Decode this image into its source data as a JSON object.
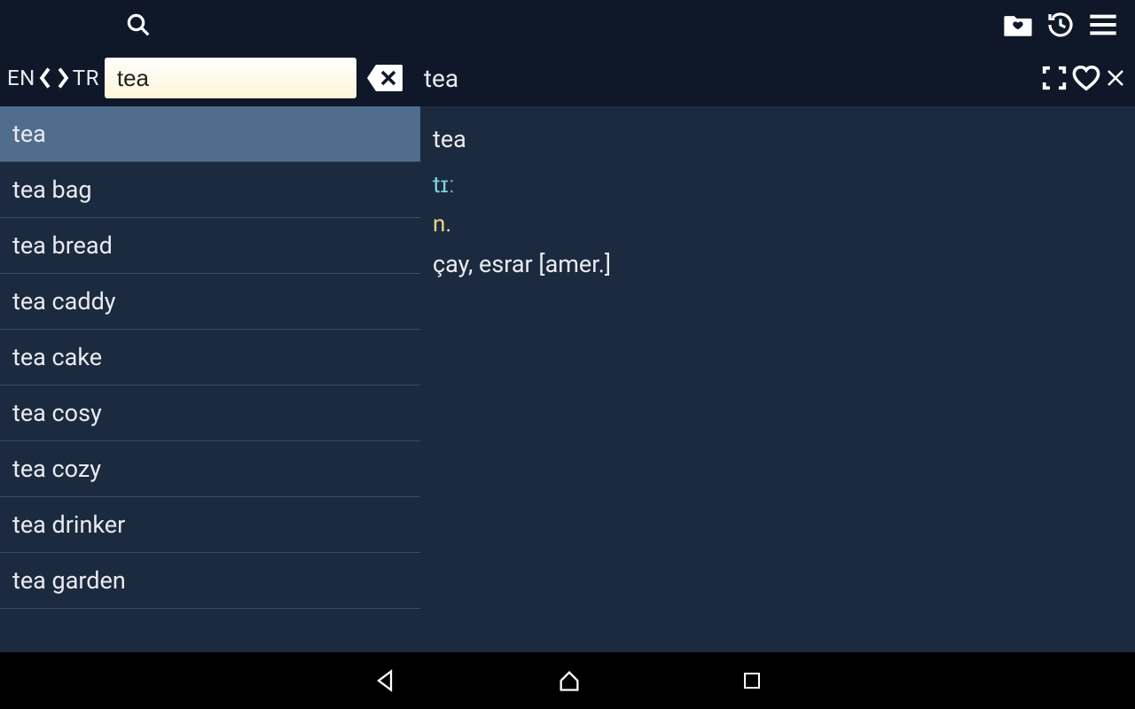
{
  "toolbar": {
    "source_lang": "EN",
    "target_lang": "TR",
    "search_value": "tea",
    "current_word": "tea"
  },
  "suggestions": [
    "tea",
    "tea bag",
    "tea bread",
    "tea caddy",
    "tea cake",
    "tea cosy",
    "tea cozy",
    "tea drinker",
    "tea garden"
  ],
  "entry": {
    "word": "tea",
    "pronunciation": "tɪː",
    "part_of_speech": "n.",
    "definition": "çay, esrar [amer.]"
  }
}
